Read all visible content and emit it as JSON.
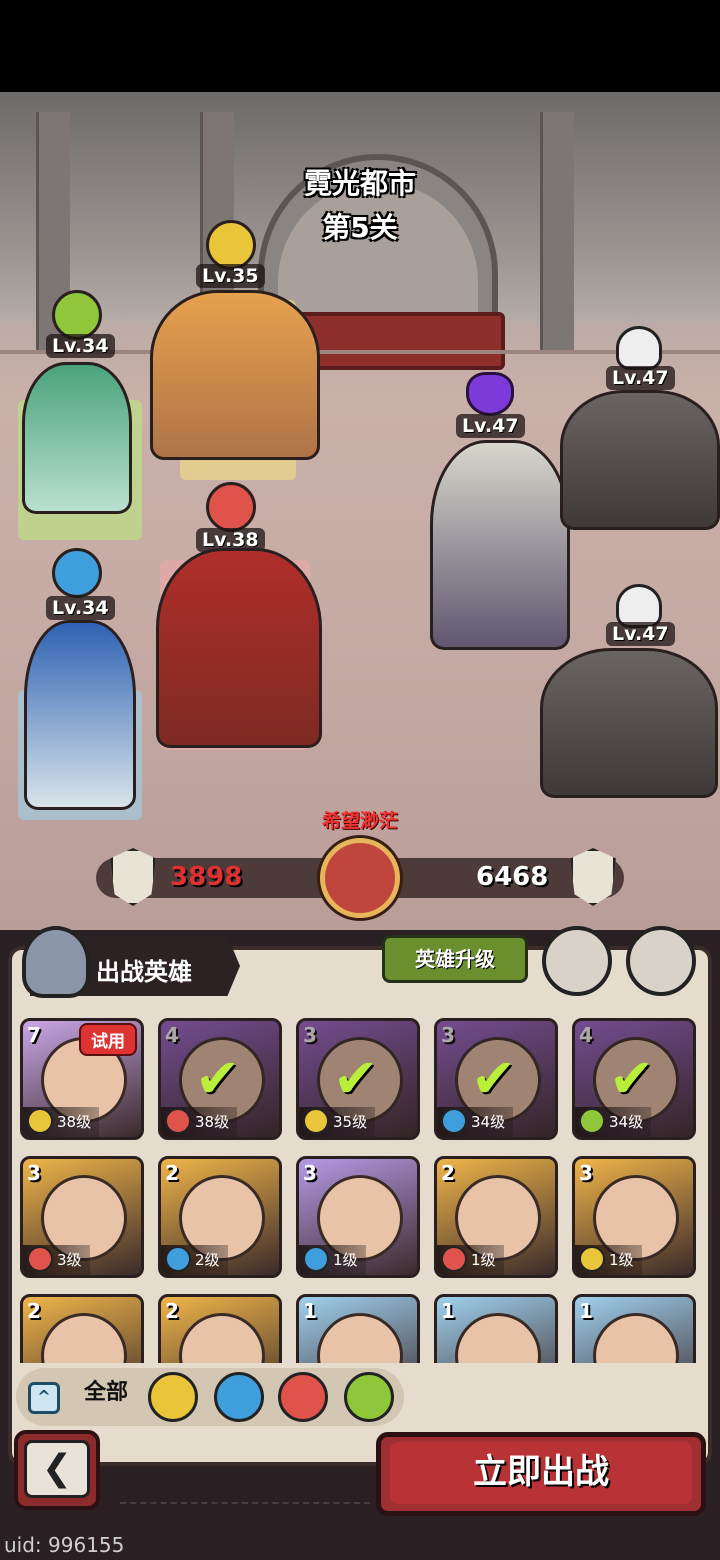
{
  "stage": {
    "city": "霓光都市",
    "level": "第5关"
  },
  "allies": [
    {
      "name": "green-elf-sorceress",
      "level": "Lv.34",
      "element": "wind",
      "color": "#8fc63a"
    },
    {
      "name": "bearded-fist-warrior",
      "level": "Lv.35",
      "element": "earth",
      "color": "#e9c53a"
    },
    {
      "name": "red-spear-warrior",
      "level": "Lv.38",
      "element": "fire",
      "color": "#e0534b"
    },
    {
      "name": "blue-elf-mage",
      "level": "Lv.34",
      "element": "water",
      "color": "#3f9fdc"
    }
  ],
  "enemies": [
    {
      "name": "dark-armored-queen",
      "level": "Lv.47",
      "marker": "demon"
    },
    {
      "name": "mech-golem-top",
      "level": "Lv.47",
      "marker": "skull"
    },
    {
      "name": "mech-golem-bottom",
      "level": "Lv.47",
      "marker": "skull"
    }
  ],
  "battle": {
    "warning": "希望渺茫",
    "my_power": "3898",
    "enemy_power": "6468"
  },
  "panel": {
    "title": "出战英雄",
    "upgrade_label": "英雄升级",
    "filter_all": "全部",
    "deploy_label": "立即出战"
  },
  "colors": {
    "earth": "#e9c53a",
    "fire": "#e0534b",
    "water": "#3f9fdc",
    "wind": "#8fc63a"
  },
  "heroes": [
    {
      "stars": "7",
      "level": "38级",
      "element": "earth",
      "frame": "#c9a7e8",
      "selected": false,
      "trial": "试用"
    },
    {
      "stars": "4",
      "level": "38级",
      "element": "fire",
      "frame": "#a46ad8",
      "selected": true
    },
    {
      "stars": "3",
      "level": "35级",
      "element": "earth",
      "frame": "#a46ad8",
      "selected": true
    },
    {
      "stars": "3",
      "level": "34级",
      "element": "water",
      "frame": "#a46ad8",
      "selected": true
    },
    {
      "stars": "4",
      "level": "34级",
      "element": "wind",
      "frame": "#a46ad8",
      "selected": true
    },
    {
      "stars": "3",
      "level": "3级",
      "element": "fire",
      "frame": "#f0b54a",
      "selected": false
    },
    {
      "stars": "2",
      "level": "2级",
      "element": "water",
      "frame": "#f0b54a",
      "selected": false
    },
    {
      "stars": "3",
      "level": "1级",
      "element": "water",
      "frame": "#b69ae6",
      "selected": false
    },
    {
      "stars": "2",
      "level": "1级",
      "element": "fire",
      "frame": "#f0b54a",
      "selected": false
    },
    {
      "stars": "3",
      "level": "1级",
      "element": "earth",
      "frame": "#f0b54a",
      "selected": false
    },
    {
      "stars": "2",
      "level": "",
      "element": "earth",
      "frame": "#f0b54a",
      "selected": false
    },
    {
      "stars": "2",
      "level": "",
      "element": "wind",
      "frame": "#f0b54a",
      "selected": false
    },
    {
      "stars": "1",
      "level": "",
      "element": "fire",
      "frame": "#9fd0ee",
      "selected": false
    },
    {
      "stars": "1",
      "level": "",
      "element": "water",
      "frame": "#9fd0ee",
      "selected": false
    },
    {
      "stars": "1",
      "level": "",
      "element": "water",
      "frame": "#9fd0ee",
      "selected": false
    }
  ],
  "footer": {
    "uid": "uid: 996155"
  }
}
